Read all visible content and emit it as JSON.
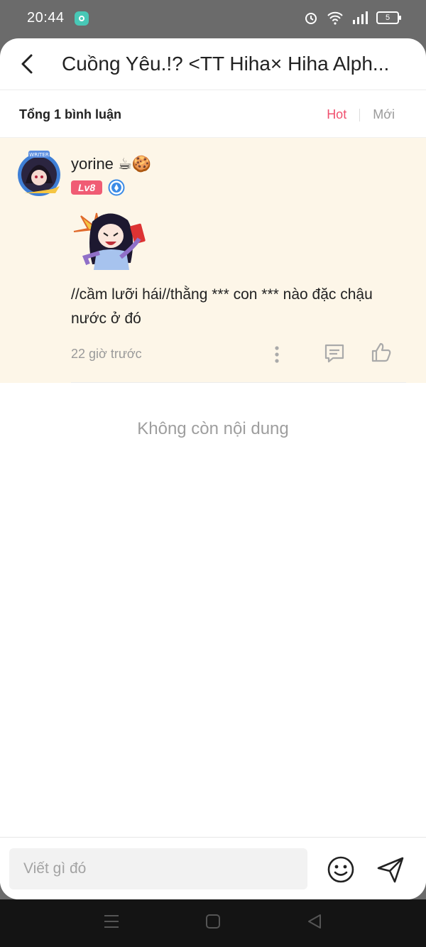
{
  "status_bar": {
    "time": "20:44",
    "battery": "5"
  },
  "header": {
    "title": "Cuồng Yêu.!? <TT Hiha× Hiha Alph..."
  },
  "comments_bar": {
    "total_label": "Tổng 1 bình luận",
    "sort_hot": "Hot",
    "sort_new": "Mới"
  },
  "comment": {
    "username": "yorine ☕🍪",
    "level": "Lv8",
    "text": "//cầm lưỡi hái//thằng *** con *** nào đặc chậu nước ở đó",
    "time": "22 giờ trước"
  },
  "empty_message": "Không còn nội dung",
  "composer": {
    "placeholder": "Viết gì đó"
  },
  "colors": {
    "accent": "#f0506e",
    "comment_bg": "#fdf6e8",
    "level_badge": "#f05c74"
  }
}
